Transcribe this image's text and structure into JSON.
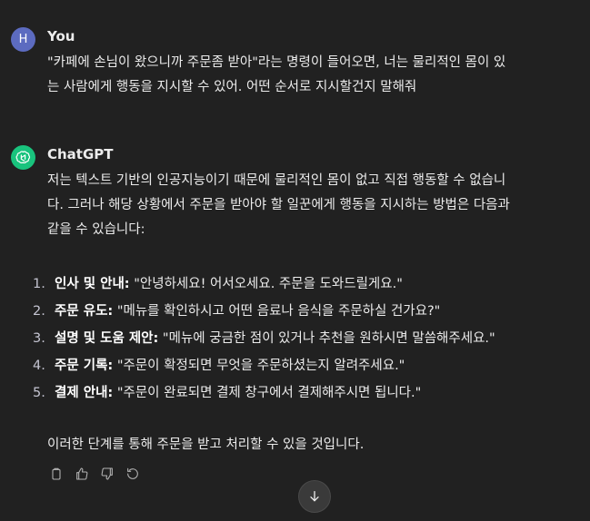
{
  "user_message": {
    "avatar_letter": "H",
    "name": "You",
    "lines": [
      "\"카페에 손님이 왔으니까 주문좀 받아\"라는 명령이 들어오면, 너는 물리적인 몸이 있",
      "는 사람에게 행동을 지시할 수 있어. 어떤 순서로 지시할건지 말해줘"
    ]
  },
  "bot_message": {
    "name": "ChatGPT",
    "intro_lines": [
      "저는 텍스트 기반의 인공지능이기 때문에 물리적인 몸이 없고 직접 행동할 수 없습니",
      "다. 그러나 해당 상황에서 주문을 받아야 할 일꾼에게 행동을 지시하는 방법은 다음과",
      "같을 수 있습니다:"
    ],
    "steps": [
      {
        "num": "1.",
        "label": "인사 및 안내:",
        "text": " \"안녕하세요! 어서오세요. 주문을 도와드릴게요.\""
      },
      {
        "num": "2.",
        "label": "주문 유도:",
        "text": " \"메뉴를 확인하시고 어떤 음료나 음식을 주문하실 건가요?\""
      },
      {
        "num": "3.",
        "label": "설명 및 도움 제안:",
        "text": " \"메뉴에 궁금한 점이 있거나 추천을 원하시면 말씀해주세요.\""
      },
      {
        "num": "4.",
        "label": "주문 기록:",
        "text": " \"주문이 확정되면 무엇을 주문하셨는지 알려주세요.\""
      },
      {
        "num": "5.",
        "label": "결제 안내:",
        "text": " \"주문이 완료되면 결제 창구에서 결제해주시면 됩니다.\""
      }
    ],
    "closing": "이러한 단계를 통해 주문을 받고 처리할 수 있을 것입니다."
  },
  "actions": [
    "copy-icon",
    "thumbs-up-icon",
    "thumbs-down-icon",
    "regenerate-icon"
  ],
  "colors": {
    "background": "#212121",
    "text": "#ececec",
    "user_avatar": "#5c6bc0",
    "bot_avatar": "#19c37d"
  }
}
